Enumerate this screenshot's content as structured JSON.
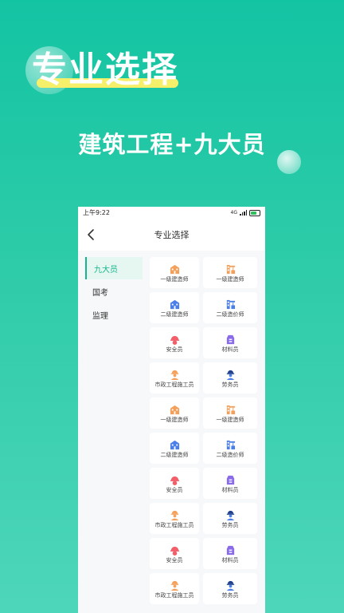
{
  "hero": {
    "title": "专业选择",
    "subtitle": "建筑工程+九大员"
  },
  "status_bar": {
    "time": "上午9:22",
    "network": "4G"
  },
  "nav": {
    "title": "专业选择"
  },
  "sidebar": {
    "items": [
      {
        "label": "九大员",
        "active": true
      },
      {
        "label": "国考",
        "active": false
      },
      {
        "label": "监理",
        "active": false
      }
    ]
  },
  "accent_color": "#16b68c",
  "grid": {
    "items": [
      {
        "label": "一级建造师",
        "icon": "building-icon",
        "color": "#f5a05a"
      },
      {
        "label": "一级建造师",
        "icon": "crane-icon",
        "color": "#f5a05a"
      },
      {
        "label": "二级建造师",
        "icon": "building-icon",
        "color": "#4a7ee8"
      },
      {
        "label": "二级造价师",
        "icon": "crane-icon",
        "color": "#4a7ee8"
      },
      {
        "label": "安全员",
        "icon": "helmet-icon",
        "color": "#f25f6a"
      },
      {
        "label": "材料员",
        "icon": "material-icon",
        "color": "#8a6be8"
      },
      {
        "label": "市政工程施工员",
        "icon": "worker-icon",
        "color": "#f5a05a"
      },
      {
        "label": "劳务员",
        "icon": "laborer-icon",
        "color": "#4a7ee8"
      },
      {
        "label": "一级建造师",
        "icon": "building-icon",
        "color": "#f5a05a"
      },
      {
        "label": "一级建造师",
        "icon": "crane-icon",
        "color": "#f5a05a"
      },
      {
        "label": "二级建造师",
        "icon": "building-icon",
        "color": "#4a7ee8"
      },
      {
        "label": "二级造价师",
        "icon": "crane-icon",
        "color": "#4a7ee8"
      },
      {
        "label": "安全员",
        "icon": "helmet-icon",
        "color": "#f25f6a"
      },
      {
        "label": "材料员",
        "icon": "material-icon",
        "color": "#8a6be8"
      },
      {
        "label": "市政工程施工员",
        "icon": "worker-icon",
        "color": "#f5a05a"
      },
      {
        "label": "劳务员",
        "icon": "laborer-icon",
        "color": "#4a7ee8"
      },
      {
        "label": "安全员",
        "icon": "helmet-icon",
        "color": "#f25f6a"
      },
      {
        "label": "材料员",
        "icon": "material-icon",
        "color": "#8a6be8"
      },
      {
        "label": "市政工程施工员",
        "icon": "worker-icon",
        "color": "#f5a05a"
      },
      {
        "label": "劳务员",
        "icon": "laborer-icon",
        "color": "#4a7ee8"
      }
    ]
  }
}
